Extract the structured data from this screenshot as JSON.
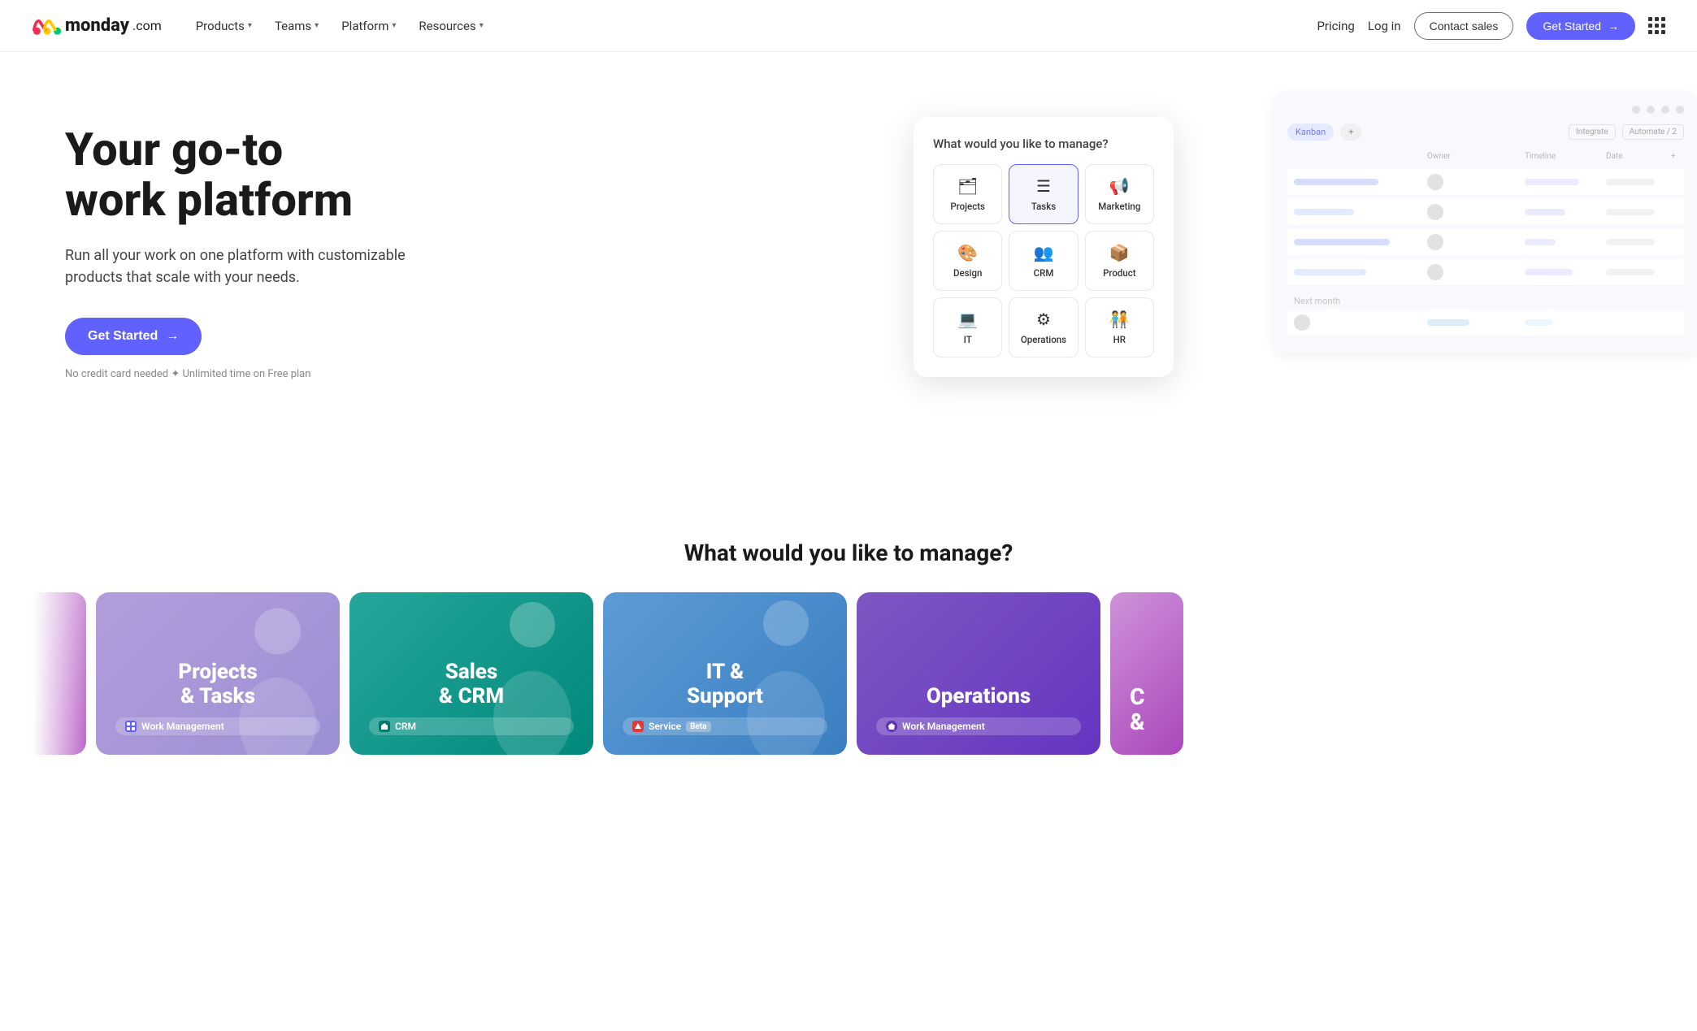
{
  "logo": {
    "text": "monday",
    "suffix": ".com"
  },
  "nav": {
    "links": [
      {
        "label": "Products",
        "id": "products"
      },
      {
        "label": "Teams",
        "id": "teams"
      },
      {
        "label": "Platform",
        "id": "platform"
      },
      {
        "label": "Resources",
        "id": "resources"
      }
    ],
    "pricing": "Pricing",
    "login": "Log in",
    "contact": "Contact sales",
    "get_started": "Get Started"
  },
  "hero": {
    "title_line1": "Your go-to",
    "title_line2": "work platform",
    "subtitle": "Run all your work on one platform with customizable products that scale with your needs.",
    "cta": "Get Started",
    "note": "No credit card needed  ✦  Unlimited time on Free plan"
  },
  "manage_modal": {
    "title": "What would you like to manage?",
    "items": [
      {
        "label": "Projects",
        "icon": "🗂",
        "id": "projects"
      },
      {
        "label": "Tasks",
        "icon": "☰",
        "id": "tasks",
        "active": true
      },
      {
        "label": "Marketing",
        "icon": "📢",
        "id": "marketing"
      },
      {
        "label": "Design",
        "icon": "🎨",
        "id": "design"
      },
      {
        "label": "CRM",
        "icon": "👥",
        "id": "crm"
      },
      {
        "label": "Product",
        "icon": "📦",
        "id": "product"
      },
      {
        "label": "IT",
        "icon": "💻",
        "id": "it"
      },
      {
        "label": "Operations",
        "icon": "⚙",
        "id": "operations"
      },
      {
        "label": "HR",
        "icon": "🧑‍🤝‍🧑",
        "id": "hr"
      }
    ]
  },
  "board": {
    "tabs": [
      "Kanban",
      "+"
    ],
    "actions": [
      "Integrate",
      "Automate / 2"
    ],
    "cols": [
      "",
      "Owner",
      "Timeline",
      "Date",
      "+"
    ],
    "rows": [
      {
        "bars": [
          "70%",
          "40%"
        ]
      },
      {
        "bars": [
          "50%",
          "60%"
        ]
      },
      {
        "bars": [
          "80%",
          "30%"
        ]
      },
      {
        "bars": [
          "60%",
          "55%"
        ]
      },
      {
        "bars": [
          "45%",
          "70%"
        ]
      }
    ]
  },
  "section": {
    "title": "What would you like to manage?"
  },
  "cards": [
    {
      "id": "partial",
      "color": "card-partial-left",
      "title": "",
      "badge": "",
      "partial": true
    },
    {
      "id": "projects-tasks",
      "color": "card-purple",
      "title": "Projects\n& Tasks",
      "badge_icon": "🟦",
      "badge_label": "Work Management"
    },
    {
      "id": "sales-crm",
      "color": "card-teal",
      "title": "Sales\n& CRM",
      "badge_icon": "🔷",
      "badge_label": "CRM"
    },
    {
      "id": "it-support",
      "color": "card-blue",
      "title": "IT &\nSupport",
      "badge_icon": "⚡",
      "badge_label": "Service",
      "badge_extra": "Beta"
    },
    {
      "id": "operations",
      "color": "card-violet",
      "title": "Operations",
      "badge_icon": "⬡",
      "badge_label": "Work Management"
    },
    {
      "id": "partial-right",
      "color": "card-partial-left",
      "title": "C...",
      "partial": true
    }
  ]
}
